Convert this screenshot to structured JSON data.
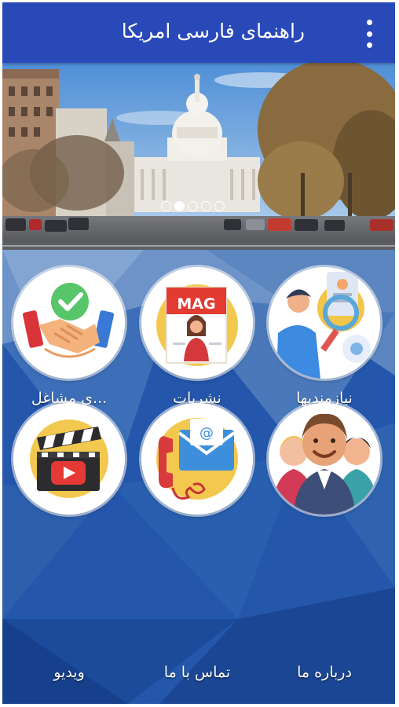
{
  "app_bar": {
    "title": "راهنمای فارسی امریکا",
    "menu_icon": "more-vert-icon",
    "background": "#2a49b8"
  },
  "banner": {
    "slides_count": 5,
    "active_slide": 2
  },
  "grid": {
    "items": [
      {
        "label": "نیازمندیها",
        "icon": "recruitment-icon"
      },
      {
        "label": "نشریات",
        "icon": "mag-publication-icon",
        "icon_text": "MAG"
      },
      {
        "label": "...ی مشاغل",
        "icon": "business-handshake-icon"
      },
      {
        "label": "درباره ما",
        "icon": "people-group-icon"
      },
      {
        "label": "تماس با ما",
        "icon": "contact-phone-mail-icon"
      },
      {
        "label": "ویدیو",
        "icon": "video-clapper-icon"
      }
    ]
  },
  "colors": {
    "background": "#1f4fa3",
    "tile_circle": "#ffffff",
    "label": "#ffffff"
  }
}
